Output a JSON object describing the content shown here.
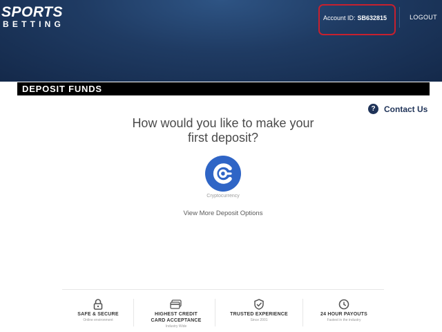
{
  "header": {
    "logo_top": "SPORTS",
    "logo_bottom": "BETTING",
    "account_label": "Account ID:",
    "account_id": "SB632815",
    "logout_label": "LOGOUT"
  },
  "page": {
    "section_title": "DEPOSIT FUNDS",
    "contact_icon": "?",
    "contact_label": "Contact Us",
    "question_line1": "How would you like to make your",
    "question_line2": "first deposit?",
    "option_label": "Cryptocurrency",
    "more_options_label": "View More Deposit Options"
  },
  "features": [
    {
      "icon": "lock-icon",
      "title": "SAFE & SECURE",
      "subtitle": "Online environment"
    },
    {
      "icon": "credit-card-icon",
      "title_line1": "HIGHEST CREDIT",
      "title_line2": "CARD ACCEPTANCE",
      "subtitle": "Industry Wide"
    },
    {
      "icon": "shield-check-icon",
      "title": "TRUSTED EXPERIENCE",
      "subtitle": "Since 2001"
    },
    {
      "icon": "clock-icon",
      "title": "24 HOUR PAYOUTS",
      "subtitle": "Fastest in the industry"
    }
  ],
  "colors": {
    "header_blue": "#1f3b63",
    "highlight_red": "#c8202e",
    "crypto_blue": "#2f65c6",
    "contact_navy": "#1f3358"
  }
}
